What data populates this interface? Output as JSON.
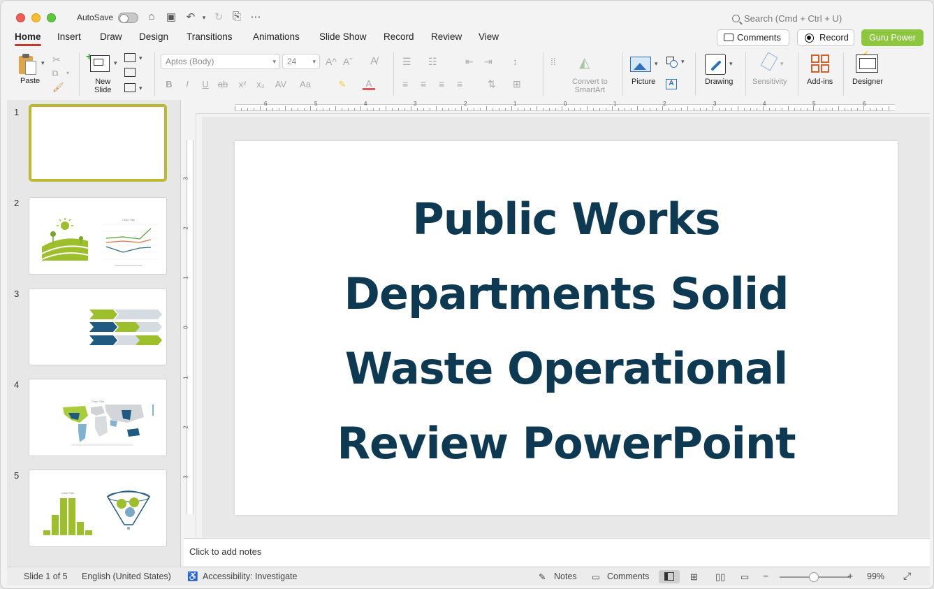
{
  "titlebar": {
    "autosave_label": "AutoSave",
    "search_placeholder": "Search (Cmd + Ctrl + U)"
  },
  "tabs": [
    {
      "label": "Home",
      "active": true
    },
    {
      "label": "Insert"
    },
    {
      "label": "Draw"
    },
    {
      "label": "Design"
    },
    {
      "label": "Transitions"
    },
    {
      "label": "Animations"
    },
    {
      "label": "Slide Show"
    },
    {
      "label": "Record"
    },
    {
      "label": "Review"
    },
    {
      "label": "View"
    }
  ],
  "header_buttons": {
    "comments": "Comments",
    "record": "Record",
    "guru": "Guru Power"
  },
  "ribbon": {
    "paste": "Paste",
    "new_slide_line1": "New",
    "new_slide_line2": "Slide",
    "font_name": "Aptos (Body)",
    "font_size": "24",
    "convert_line1": "Convert to",
    "convert_line2": "SmartArt",
    "picture": "Picture",
    "drawing": "Drawing",
    "sensitivity": "Sensitivity",
    "addins": "Add-ins",
    "designer": "Designer",
    "bold": "B",
    "italic": "I",
    "underline": "U",
    "strike": "ab",
    "superscript": "x²",
    "subscript": "x₂",
    "spacing": "AV",
    "case": "Aa",
    "grow_font": "A^",
    "shrink_font": "Aˇ",
    "font_color": "A"
  },
  "thumbnails": [
    "1",
    "2",
    "3",
    "4",
    "5"
  ],
  "thumbnail_text": {
    "chart_title": "Chart Title"
  },
  "ruler": {
    "h_numbers": [
      "6",
      "5",
      "4",
      "3",
      "2",
      "1",
      "0",
      "1",
      "2",
      "3",
      "4",
      "5",
      "6"
    ],
    "v_numbers": [
      "3",
      "2",
      "1",
      "0",
      "1",
      "2",
      "3"
    ]
  },
  "slide": {
    "title_lines": [
      "Public Works",
      "Departments Solid",
      "Waste Operational",
      "Review PowerPoint"
    ]
  },
  "notes_placeholder": "Click to add notes",
  "status": {
    "slide_info": "Slide 1 of 5",
    "language": "English (United States)",
    "accessibility": "Accessibility: Investigate",
    "notes": "Notes",
    "comments": "Comments",
    "zoom": "99%"
  },
  "colors": {
    "accent_green": "#8dc63f",
    "title_navy": "#0d3a52",
    "tab_underline": "#c0392b"
  }
}
